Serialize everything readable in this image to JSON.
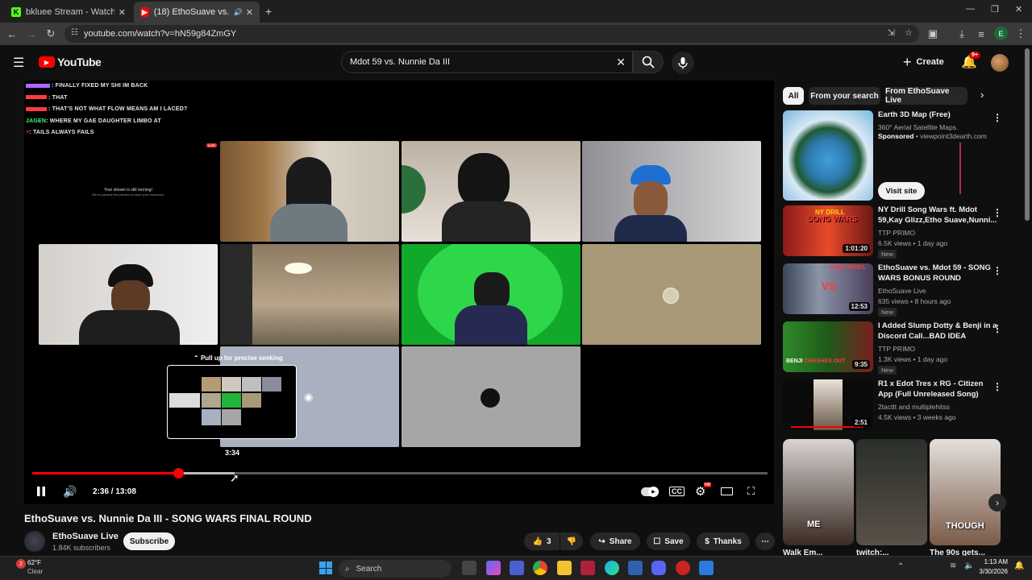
{
  "browser": {
    "tabs": [
      {
        "title": "bkluee Stream - Watch Live on",
        "favicon_color": "#53fc18",
        "favicon_letter": "K"
      },
      {
        "title": "(18) EthoSuave vs. Nunnie D",
        "favicon_color": "#ff0000",
        "favicon_letter": "▶"
      }
    ],
    "url": "youtube.com/watch?v=hN59g84ZmGY",
    "profile_letter": "E"
  },
  "youtube": {
    "logo_text": "YouTube",
    "search_value": "Mdot 59 vs. Nunnie Da III",
    "create_label": "Create",
    "notif_count": "9+"
  },
  "player": {
    "chat_lines": [
      {
        "user": "",
        "text": ": FINALLY FIXED MY SHI IM BACK",
        "color": "#b066ff"
      },
      {
        "user": "",
        "text": ": THAT",
        "color": "#ff3b3b"
      },
      {
        "user": "",
        "text": ": THAT'S NOT WHAT FLOW MEANS AM I LACED?",
        "color": "#ff3b3b"
      },
      {
        "user": "JAGEN",
        "text": ": WHERE MY GAE DAUGHTER LIMBO AT",
        "color": "#3cff7a"
      },
      {
        "user": "",
        "text": ": TAILS ALWAYS FAILS",
        "color": "#ff3b3b"
      }
    ],
    "stream_notice_1": "Your stream is still running!",
    "stream_notice_2": "We've paused this preview to save your resources.",
    "live_badge": "LIVE",
    "seek_hint": "Pull up for precise seeking",
    "preview_time": "3:34",
    "current_time": "2:36 / 13:08",
    "progress_fraction": 0.198,
    "buffered_fraction": 0.275,
    "quality_badge": "HD"
  },
  "video": {
    "title": "EthoSuave vs. Nunnie Da III - SONG WARS FINAL ROUND",
    "channel": "EthoSuave Live",
    "subscribers": "1.84K subscribers",
    "subscribe_label": "Subscribe",
    "likes": "3",
    "share_label": "Share",
    "save_label": "Save",
    "thanks_label": "Thanks"
  },
  "sidebar": {
    "chips": [
      "All",
      "From your search",
      "From EthoSuave Live"
    ],
    "ad": {
      "title": "Earth 3D Map (Free)",
      "subtitle": "360° Aerial Satellite Maps.",
      "sponsored": "Sponsored",
      "domain": "viewpoint3dearth.com",
      "cta": "Visit site"
    },
    "recs": [
      {
        "title": "NY Drill Song Wars ft. Mdot 59,Kay Glizz,Etho Suave,Nunni...",
        "channel": "TTP PRIMO",
        "meta": "6.5K views • 1 day ago",
        "badge": "New",
        "duration": "1:01:20"
      },
      {
        "title": "EthoSuave vs. Mdot 59 - SONG WARS BONUS ROUND",
        "channel": "EthoSuave Live",
        "meta": "635 views • 8 hours ago",
        "badge": "New",
        "duration": "12:53"
      },
      {
        "title": "I Added Slump Dotty & Benji in a Discord Call...BAD IDEA",
        "channel": "TTP PRIMO",
        "meta": "1.3K views • 1 day ago",
        "badge": "New",
        "duration": "9:35"
      },
      {
        "title": "R1 x Edot Tres x RG - Citizen App (Full Unreleased Song)",
        "channel": "2tacttt and multiplehitss",
        "meta": "4.5K views • 3 weeks ago",
        "badge": "",
        "duration": "2:51"
      }
    ],
    "shorts": [
      {
        "title": "Walk Em...",
        "caption": "ME"
      },
      {
        "title": "twitch:...",
        "caption": ""
      },
      {
        "title": "The 90s gets...",
        "caption": "THOUGH"
      }
    ]
  },
  "taskbar": {
    "weather_temp": "62°F",
    "weather_desc": "Clear",
    "search_label": "Search",
    "time": "1:13 AM",
    "date": "3/30/2026"
  }
}
